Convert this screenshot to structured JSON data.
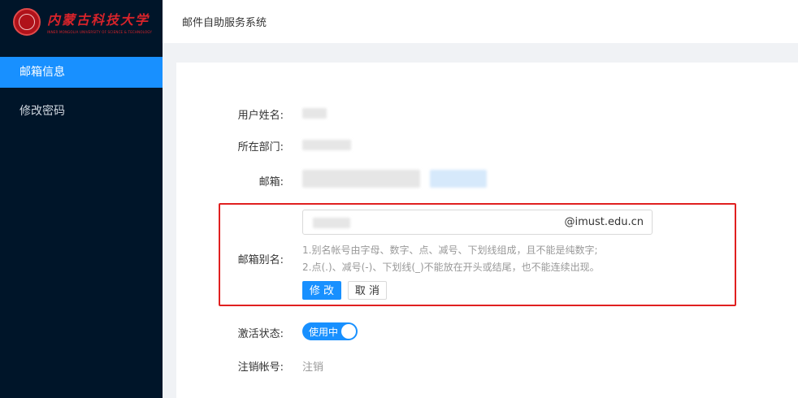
{
  "sidebar": {
    "logo": {
      "name_cn": "内蒙古科技大学",
      "name_en": "INNER MONGOLIA UNIVERSITY OF SCIENCE & TECHNOLOGY"
    },
    "items": [
      {
        "label": "邮箱信息",
        "active": true
      },
      {
        "label": "修改密码",
        "active": false
      }
    ]
  },
  "header": {
    "title": "邮件自助服务系统"
  },
  "form": {
    "user_name_label": "用户姓名:",
    "department_label": "所在部门:",
    "email_label": "邮箱:",
    "alias_label": "邮箱别名:",
    "alias_suffix": "@imust.edu.cn",
    "hint_line1": "1.别名帐号由字母、数字、点、减号、下划线组成，且不能是纯数字;",
    "hint_line2": "2.点(.)、减号(-)、下划线(_)不能放在开头或结尾，也不能连续出现。",
    "modify_button": "修 改",
    "cancel_button": "取 消",
    "status_label": "激活状态:",
    "status_value": "使用中",
    "deregister_label": "注销帐号:",
    "deregister_link": "注销"
  },
  "colors": {
    "sidebar_bg": "#001529",
    "accent": "#1890ff",
    "highlight_border": "#e02020"
  }
}
